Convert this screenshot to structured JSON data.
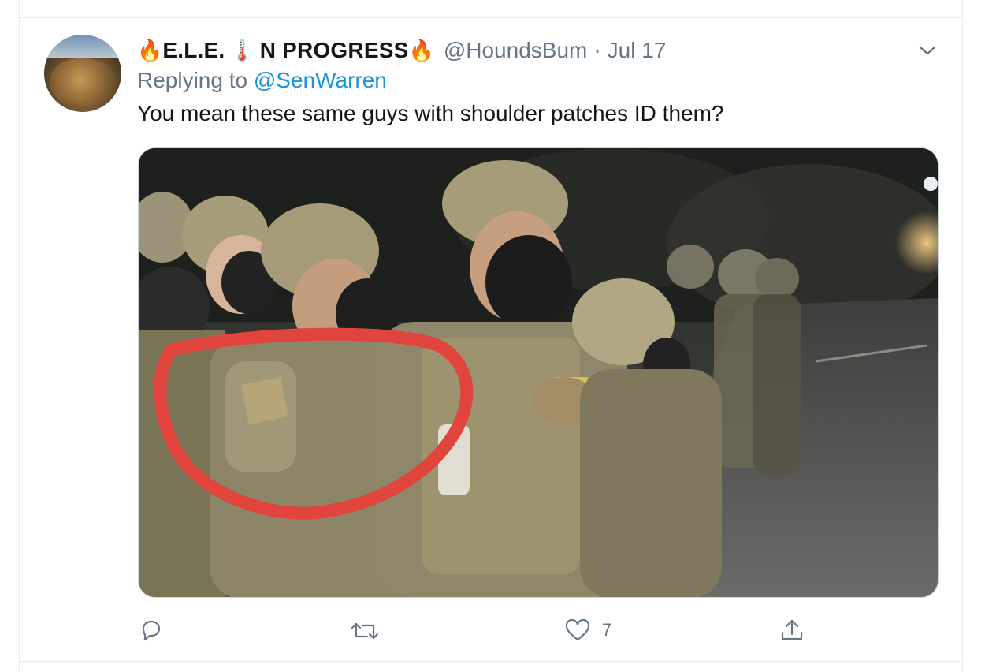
{
  "tweet": {
    "display_name_prefix_emoji": "🔥",
    "display_name_part1": "E.L.E.",
    "display_name_mid_emoji": "🌡️",
    "display_name_part2": "N PROGRESS",
    "display_name_suffix_emoji": "🔥",
    "handle": "@HoundsBum",
    "separator": "·",
    "date": "Jul 17",
    "replying_to_label": "Replying to",
    "replying_to_handle": "@SenWarren",
    "text": "You mean these same guys with shoulder patches ID them?",
    "media_icon": "photo",
    "avatar_icon": "rock-avatar"
  },
  "actions": {
    "reply_icon": "reply-icon",
    "retweet_icon": "retweet-icon",
    "like_icon": "heart-icon",
    "like_count": "7",
    "share_icon": "share-icon",
    "menu_icon": "chevron-down-icon"
  },
  "colors": {
    "text_primary": "#14171a",
    "text_secondary": "#657786",
    "link": "#1b95e0",
    "annotation_circle": "#e0443c"
  }
}
